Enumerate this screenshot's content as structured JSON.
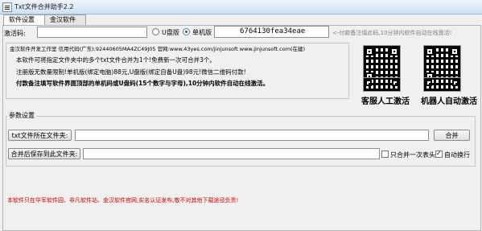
{
  "window": {
    "title": "Txt文件合并助手2.2"
  },
  "tabs": [
    {
      "label": "软件设置"
    },
    {
      "label": "金汉软件"
    }
  ],
  "activation": {
    "label": "激活码:",
    "radio_udisk": "U盘版",
    "radio_single": "单机版",
    "machine_code": "6764130fea34eae",
    "hint": "<-付款备注填此码,10分钟内软件自动在线激活!"
  },
  "info": {
    "line1": "金汉软件开发工作室  信用代码(广东):92440605MA4ZC49J05  官网:www.43yes.com/jinjunsoft  www.jinjunsoft.com(在建)",
    "line2": "本软件可将指定文件夹中的多个txt文件合并为1个!免费新一次可合并3个。",
    "line3": "注册版无数量限制!单机版(绑定电脑)88元,U盘版(绑定自备U盘)98元!微信二维码付款!",
    "line4": "付款备注填写软件界面顶部的单机码或U盘码(15个数字与字母),10分钟内软件自动在线激活。"
  },
  "qr": {
    "label_left": "客服人工激活",
    "label_right": "机器人自动激活"
  },
  "params": {
    "group_label": "参数设置",
    "src_button": "txt文件所在文件夹:",
    "src_value": "",
    "merge_button": "合并",
    "dst_button": "合并后保存到此文件夹:",
    "dst_value": "",
    "only_once_header": "只合并一次表头",
    "auto_wrap": "自动换行"
  },
  "footer": {
    "notice": "本软件只在华军软件园、非凡软件站、金汉软件官网,实名认证发布,敬不对其他下载途径负责!"
  },
  "colors": {
    "notice": "#d40000",
    "hint": "#808080"
  }
}
